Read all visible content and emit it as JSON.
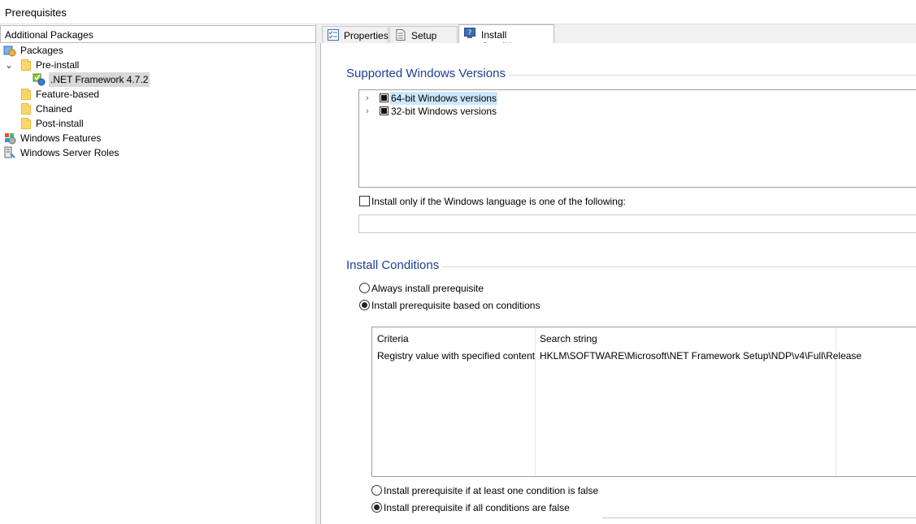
{
  "window": {
    "title": "Prerequisites"
  },
  "left": {
    "header": "Additional Packages",
    "tree": {
      "packages": "Packages",
      "pre_install": "Pre-install",
      "net_framework": ".NET Framework 4.7.2",
      "feature_based": "Feature-based",
      "chained": "Chained",
      "post_install": "Post-install",
      "windows_features": "Windows Features",
      "windows_server_roles": "Windows Server Roles"
    }
  },
  "tabs": [
    {
      "label": "Properties",
      "icon": "checklist-icon"
    },
    {
      "label": "Setup Files",
      "icon": "document-icon"
    },
    {
      "label": "Install Conditions",
      "icon": "help-monitor-icon",
      "active": true
    }
  ],
  "supported": {
    "title": "Supported Windows Versions",
    "items": [
      "64-bit Windows versions",
      "32-bit Windows versions"
    ],
    "language_checkbox": "Install only if the Windows language is one of the following:",
    "language_value": ""
  },
  "conditions": {
    "title": "Install Conditions",
    "always": "Always install prerequisite",
    "based_on": "Install prerequisite based on conditions",
    "columns": [
      "Criteria",
      "Search string"
    ],
    "rows": [
      {
        "criteria": "Registry value with specified content",
        "search": "HKLM\\SOFTWARE\\Microsoft\\NET Framework Setup\\NDP\\v4\\Full\\Release"
      }
    ],
    "at_least_one_false": "Install prerequisite if at least one condition is false",
    "all_false": "Install prerequisite if all conditions are false"
  },
  "colors": {
    "section_title": "#1c3f94",
    "selection": "#cce8ff",
    "folder": "#fbd76b"
  }
}
